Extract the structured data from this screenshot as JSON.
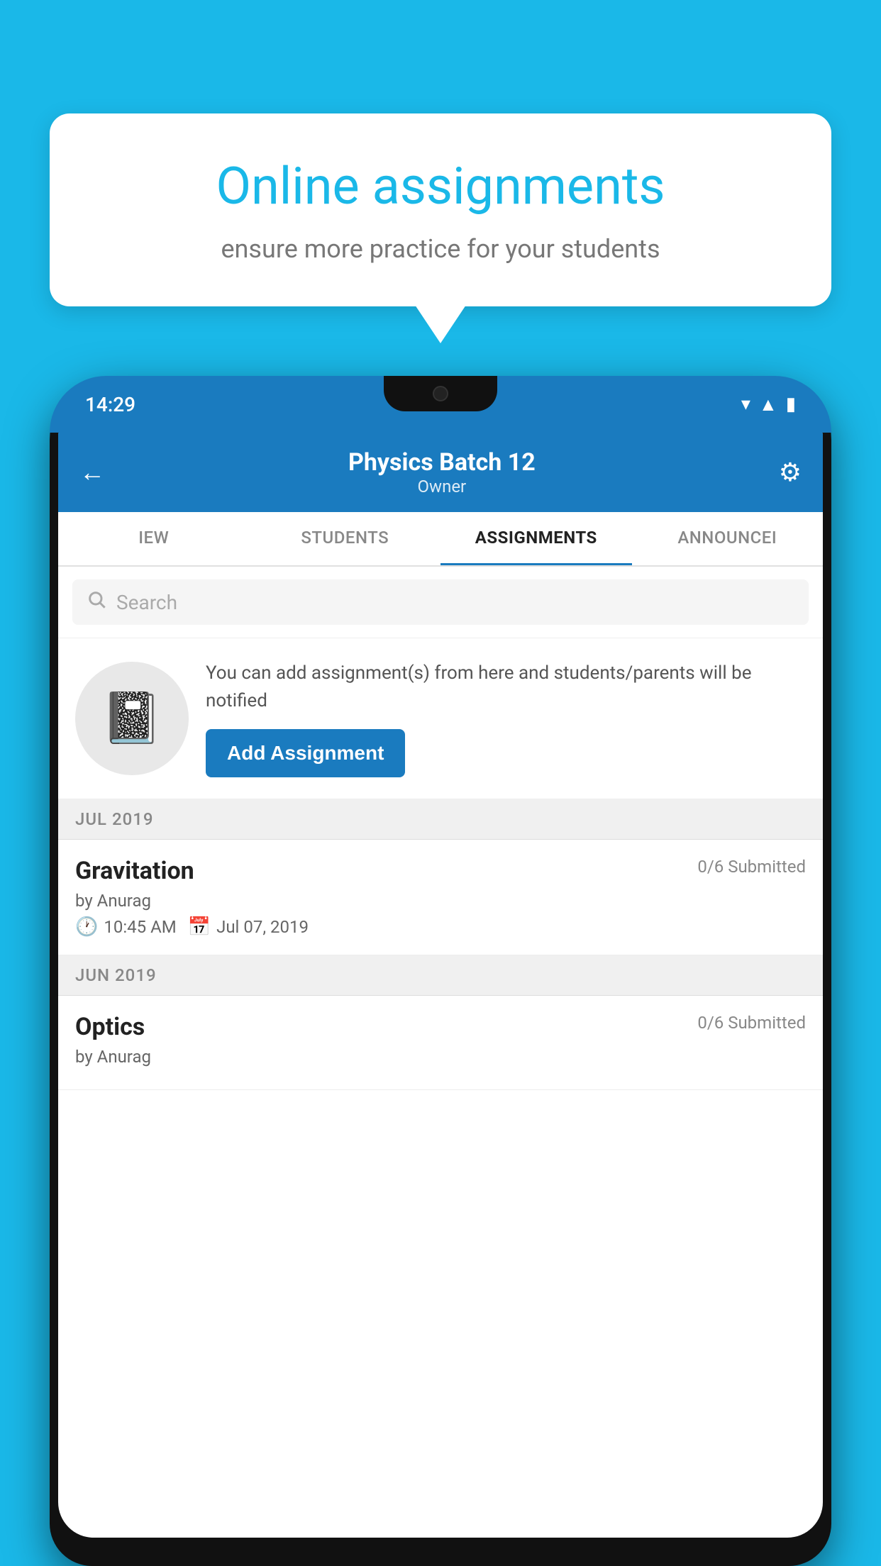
{
  "background": "#1ab8e8",
  "bubble": {
    "title": "Online assignments",
    "subtitle": "ensure more practice for your students"
  },
  "phone": {
    "status_time": "14:29",
    "header": {
      "title": "Physics Batch 12",
      "subtitle": "Owner",
      "back_label": "←",
      "settings_label": "⚙"
    },
    "tabs": [
      {
        "label": "IEW",
        "active": false
      },
      {
        "label": "STUDENTS",
        "active": false
      },
      {
        "label": "ASSIGNMENTS",
        "active": true
      },
      {
        "label": "ANNOUNCEI",
        "active": false
      }
    ],
    "search": {
      "placeholder": "Search"
    },
    "info": {
      "text": "You can add assignment(s) from here and students/parents will be notified",
      "button_label": "Add Assignment"
    },
    "assignments": [
      {
        "month": "JUL 2019",
        "items": [
          {
            "name": "Gravitation",
            "submitted": "0/6 Submitted",
            "by": "by Anurag",
            "time": "10:45 AM",
            "date": "Jul 07, 2019"
          }
        ]
      },
      {
        "month": "JUN 2019",
        "items": [
          {
            "name": "Optics",
            "submitted": "0/6 Submitted",
            "by": "by Anurag",
            "time": "",
            "date": ""
          }
        ]
      }
    ]
  }
}
